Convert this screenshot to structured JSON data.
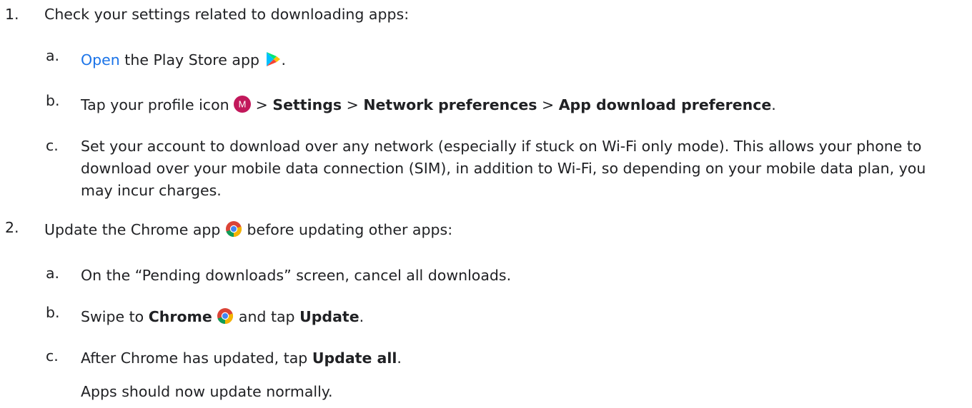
{
  "step1": {
    "number": "1.",
    "text": "Check your settings related to downloading apps:",
    "items": {
      "a": {
        "letter": "a.",
        "link": "Open",
        "text": " the Play Store app ",
        "end": "."
      },
      "b": {
        "letter": "b.",
        "prefix": "Tap your profile icon ",
        "avatar_letter": "M",
        "sep1": " > ",
        "settings": "Settings",
        "sep2": " > ",
        "network": "Network preferences",
        "sep3": " > ",
        "app_download": "App download preference",
        "end": "."
      },
      "c": {
        "letter": "c.",
        "text": "Set your account to download over any network (especially if stuck on Wi-Fi only mode). This allows your phone to download over your mobile data connection (SIM), in addition to Wi-Fi, so depending on your mobile data plan, you may incur charges."
      }
    }
  },
  "step2": {
    "number": "2.",
    "text_before": "Update the Chrome app ",
    "text_after": " before updating other apps:",
    "items": {
      "a": {
        "letter": "a.",
        "text": "On the “Pending downloads” screen, cancel all downloads."
      },
      "b": {
        "letter": "b.",
        "prefix": "Swipe to ",
        "chrome": "Chrome",
        "middle": " and tap ",
        "update": "Update",
        "end": "."
      },
      "c": {
        "letter": "c.",
        "prefix": "After Chrome has updated, tap ",
        "update_all": "Update all",
        "end": "."
      }
    },
    "footer": "Apps should now update normally."
  },
  "colors": {
    "text": "#202124",
    "link": "#1a73e8",
    "avatar_bg": "#c2185b"
  },
  "icons": {
    "play_store": "play-store-icon",
    "profile": "profile-avatar-icon",
    "chrome": "chrome-icon"
  }
}
